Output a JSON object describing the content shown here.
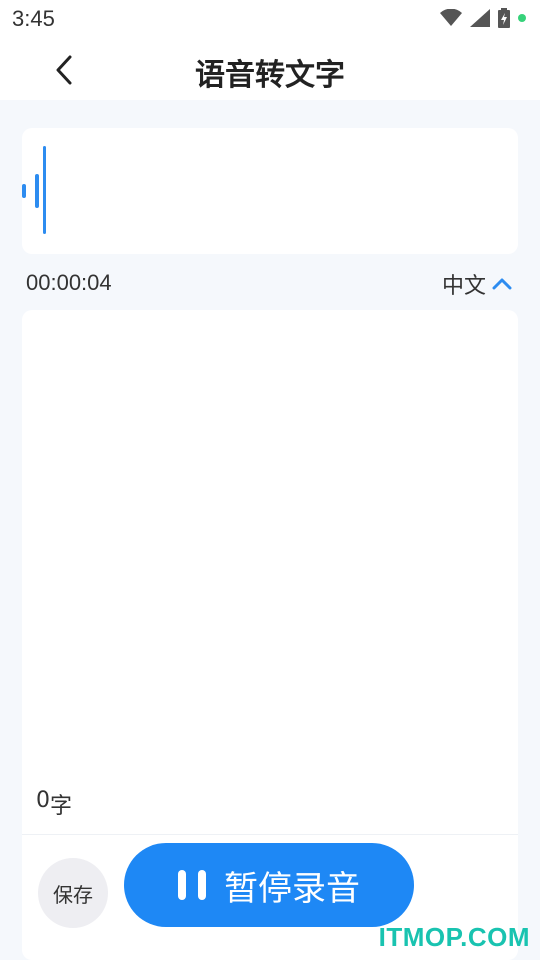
{
  "status_bar": {
    "time": "3:45",
    "icons": [
      "wifi-icon",
      "signal-icon",
      "battery-icon",
      "notification-dot"
    ],
    "dot_color": "#36d27a"
  },
  "header": {
    "title": "语音转文字",
    "back_icon": "chevron-left-icon"
  },
  "recording": {
    "elapsed": "00:00:04",
    "language": "中文",
    "language_icon": "chevron-up-icon",
    "accent_color": "#2d8cf0"
  },
  "transcript": {
    "text": "",
    "char_count": "0",
    "char_unit": "字"
  },
  "actions": {
    "save_label": "保存",
    "pause_label": "暂停录音",
    "pause_icon": "pause-icon",
    "button_color": "#1e88f5"
  },
  "watermark": "ITMOP.COM"
}
